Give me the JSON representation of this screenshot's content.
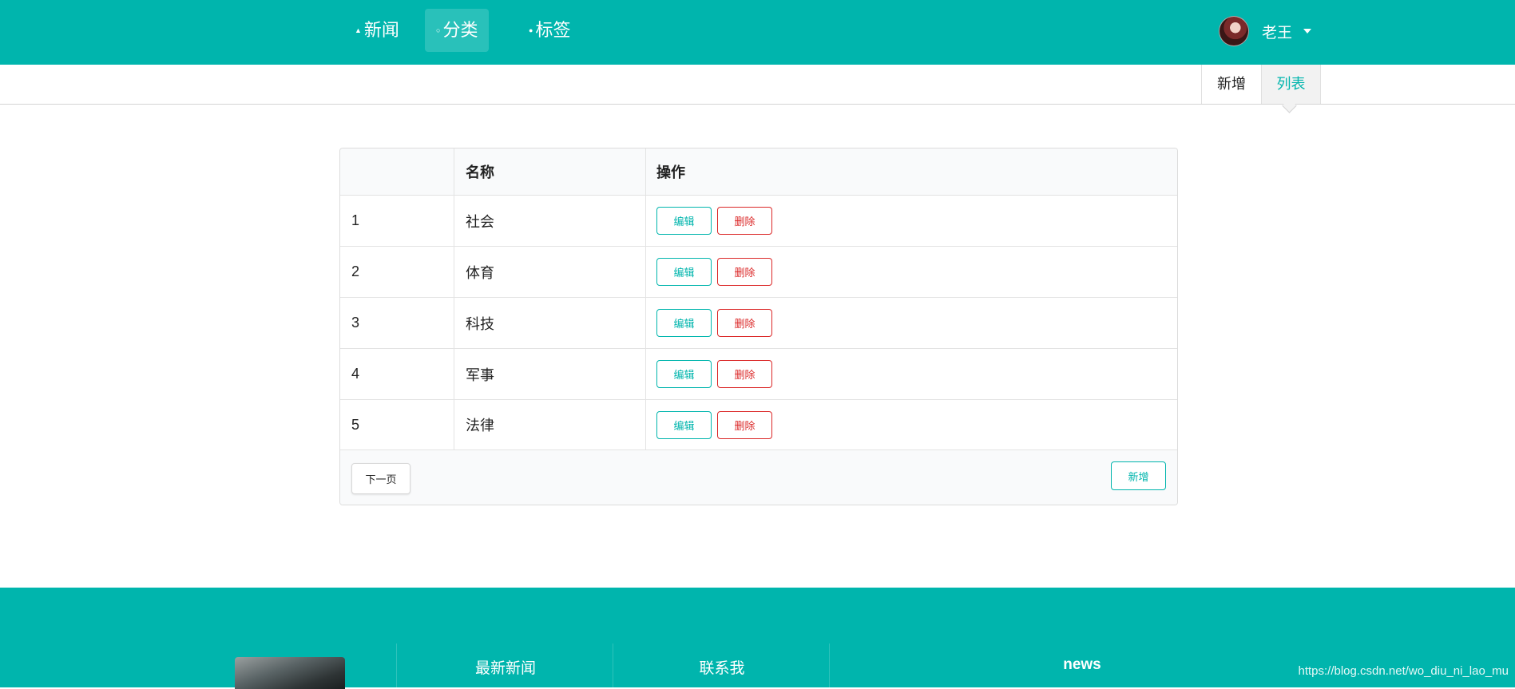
{
  "nav": {
    "items": [
      {
        "label": "新闻",
        "icon": "home-icon"
      },
      {
        "label": "分类",
        "icon": "idea-icon"
      },
      {
        "label": "标签",
        "icon": "tag-icon"
      }
    ],
    "active": "分类",
    "user_name": "老王"
  },
  "submenu": {
    "new_label": "新增",
    "list_label": "列表",
    "active": "列表"
  },
  "table": {
    "headers": [
      "",
      "名称",
      "操作"
    ],
    "rows": [
      {
        "id": "1",
        "name": "社会"
      },
      {
        "id": "2",
        "name": "体育"
      },
      {
        "id": "3",
        "name": "科技"
      },
      {
        "id": "4",
        "name": "军事"
      },
      {
        "id": "5",
        "name": "法律"
      }
    ],
    "edit_label": "编辑",
    "delete_label": "删除",
    "next_label": "下一页",
    "add_label": "新增"
  },
  "footer": {
    "latest_news": "最新新闻",
    "contact": "联系我",
    "news": "news"
  },
  "watermark": "https://blog.csdn.net/wo_diu_ni_lao_mu",
  "colors": {
    "primary": "#00b5ad",
    "danger": "#db2828"
  }
}
